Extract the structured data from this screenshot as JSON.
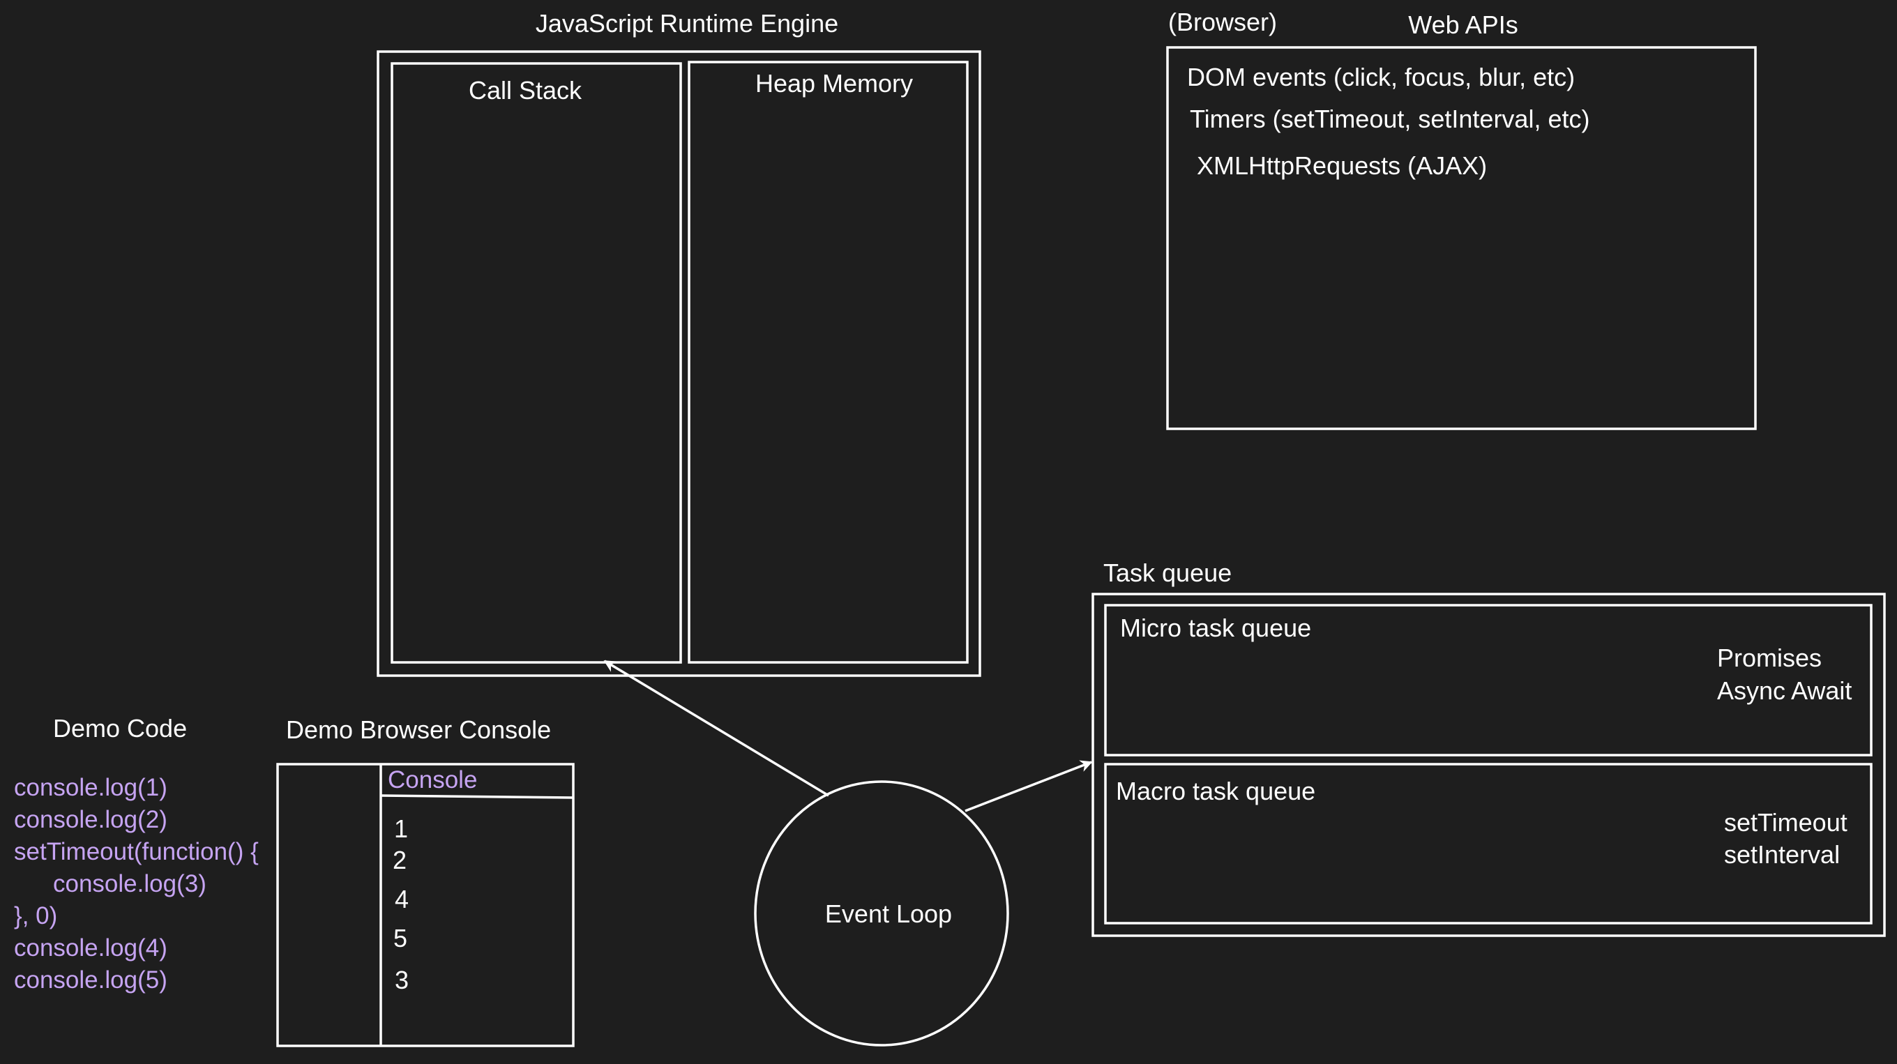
{
  "runtime": {
    "title": "JavaScript Runtime Engine",
    "call_stack": "Call Stack",
    "heap_memory": "Heap Memory"
  },
  "web_apis": {
    "browser_label": "(Browser)",
    "title": "Web APIs",
    "items": [
      "DOM events (click, focus, blur, etc)",
      "Timers (setTimeout, setInterval, etc)",
      "XMLHttpRequests (AJAX)"
    ]
  },
  "task_queue": {
    "title": "Task queue",
    "micro": {
      "title": "Micro task queue",
      "items": [
        "Promises",
        "Async Await"
      ]
    },
    "macro": {
      "title": "Macro task queue",
      "items": [
        "setTimeout",
        "setInterval"
      ]
    }
  },
  "event_loop": {
    "label": "Event Loop"
  },
  "demo_code": {
    "title": "Demo Code",
    "lines": [
      "console.log(1)",
      "console.log(2)",
      "setTimeout(function() {",
      "console.log(3)",
      "}, 0)",
      "console.log(4)",
      "console.log(5)"
    ]
  },
  "demo_console": {
    "title": "Demo Browser Console",
    "header": "Console",
    "outputs": [
      "1",
      "2",
      "4",
      "5",
      "3"
    ]
  },
  "colors": {
    "background": "#1e1e1e",
    "stroke": "#ffffff",
    "code_text": "#c6a4f2"
  }
}
